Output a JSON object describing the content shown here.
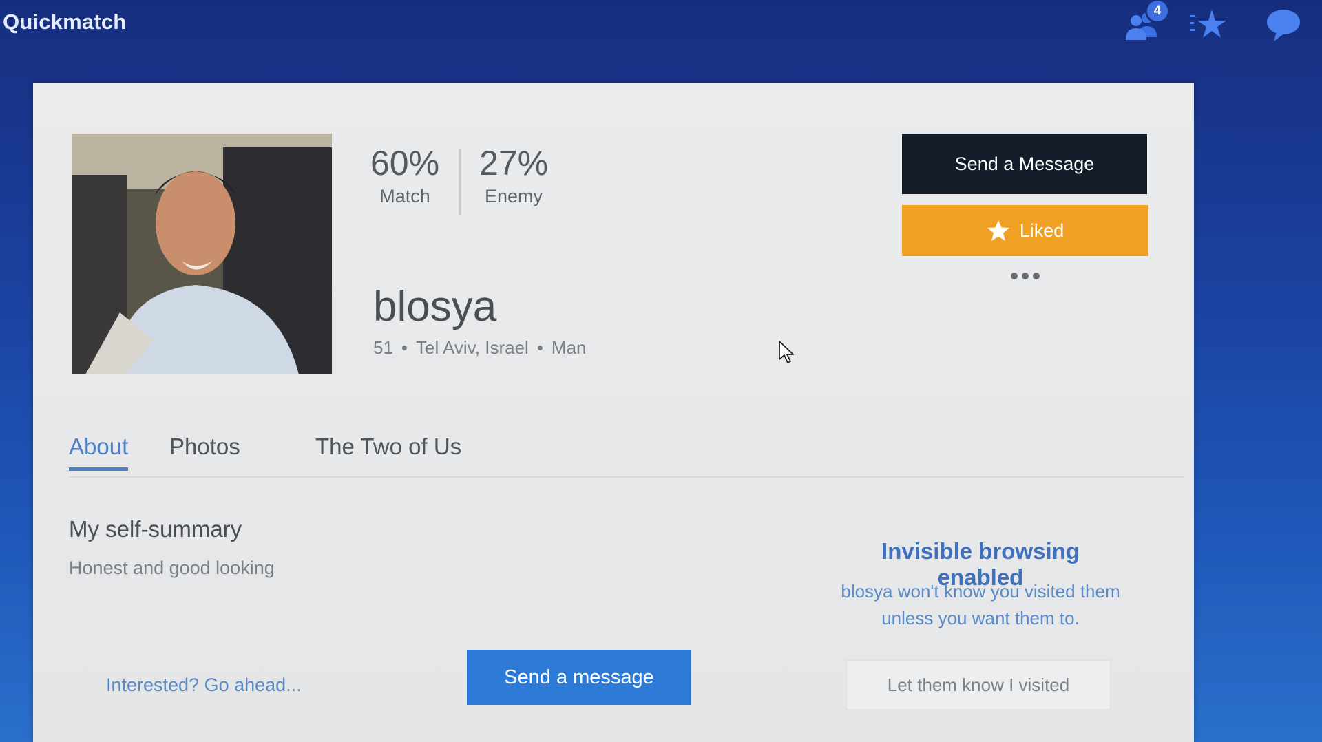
{
  "app": {
    "brand": "Quickmatch"
  },
  "header": {
    "notification_count": "4",
    "icons": [
      "people-icon",
      "star-list-icon",
      "chat-bubble-icon"
    ]
  },
  "profile": {
    "match_pct": "60%",
    "match_label": "Match",
    "enemy_pct": "27%",
    "enemy_label": "Enemy",
    "username": "blosya",
    "age": "51",
    "location": "Tel Aviv, Israel",
    "gender": "Man"
  },
  "actions": {
    "send_message": "Send a Message",
    "liked": "Liked"
  },
  "tabs": [
    {
      "label": "About",
      "active": true
    },
    {
      "label": "Photos",
      "active": false
    },
    {
      "label": "The Two of Us",
      "active": false
    }
  ],
  "about": {
    "title": "My self-summary",
    "body": "Honest and good looking"
  },
  "invisible": {
    "title": "Invisible browsing enabled",
    "body": "blosya won't know you visited them unless you want them to.",
    "button": "Let them know I visited"
  },
  "cta": {
    "text": "Interested? Go ahead...",
    "button": "Send a message"
  },
  "colors": {
    "accent_blue": "#2d7ad6",
    "liked_orange": "#f0a024",
    "dark_button": "#151d2b",
    "tab_active": "#4e80c8"
  }
}
